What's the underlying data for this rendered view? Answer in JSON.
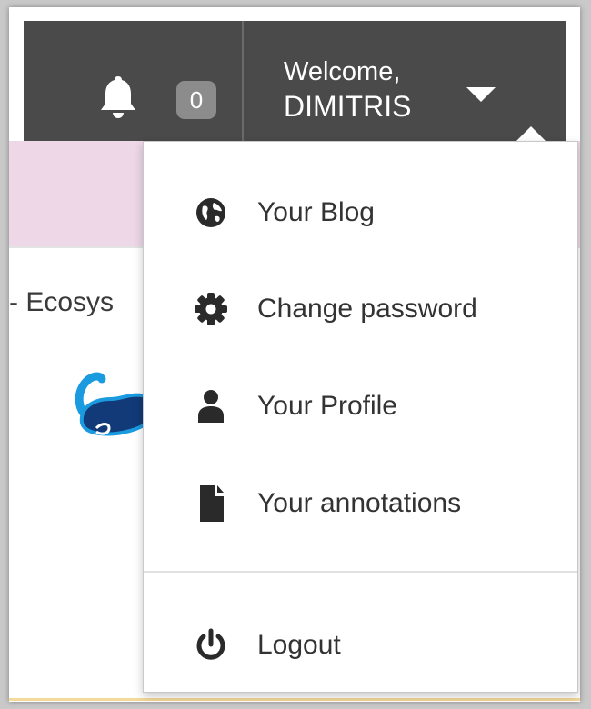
{
  "header": {
    "notification_count": "0",
    "welcome_label": "Welcome,",
    "user_name": "DIMITRIS"
  },
  "background": {
    "partial_title": "- Ecosys"
  },
  "menu": {
    "items": [
      {
        "label": "Your Blog",
        "icon": "globe-icon"
      },
      {
        "label": "Change password",
        "icon": "gear-icon"
      },
      {
        "label": "Your Profile",
        "icon": "user-icon"
      },
      {
        "label": "Your annotations",
        "icon": "file-icon"
      }
    ],
    "logout_label": "Logout",
    "logout_icon": "power-icon"
  },
  "colors": {
    "header_bg": "#4a4a4a",
    "badge_bg": "#8c8c8c",
    "pink_strip": "#eed8e8",
    "cursor": "#1a9be0"
  }
}
